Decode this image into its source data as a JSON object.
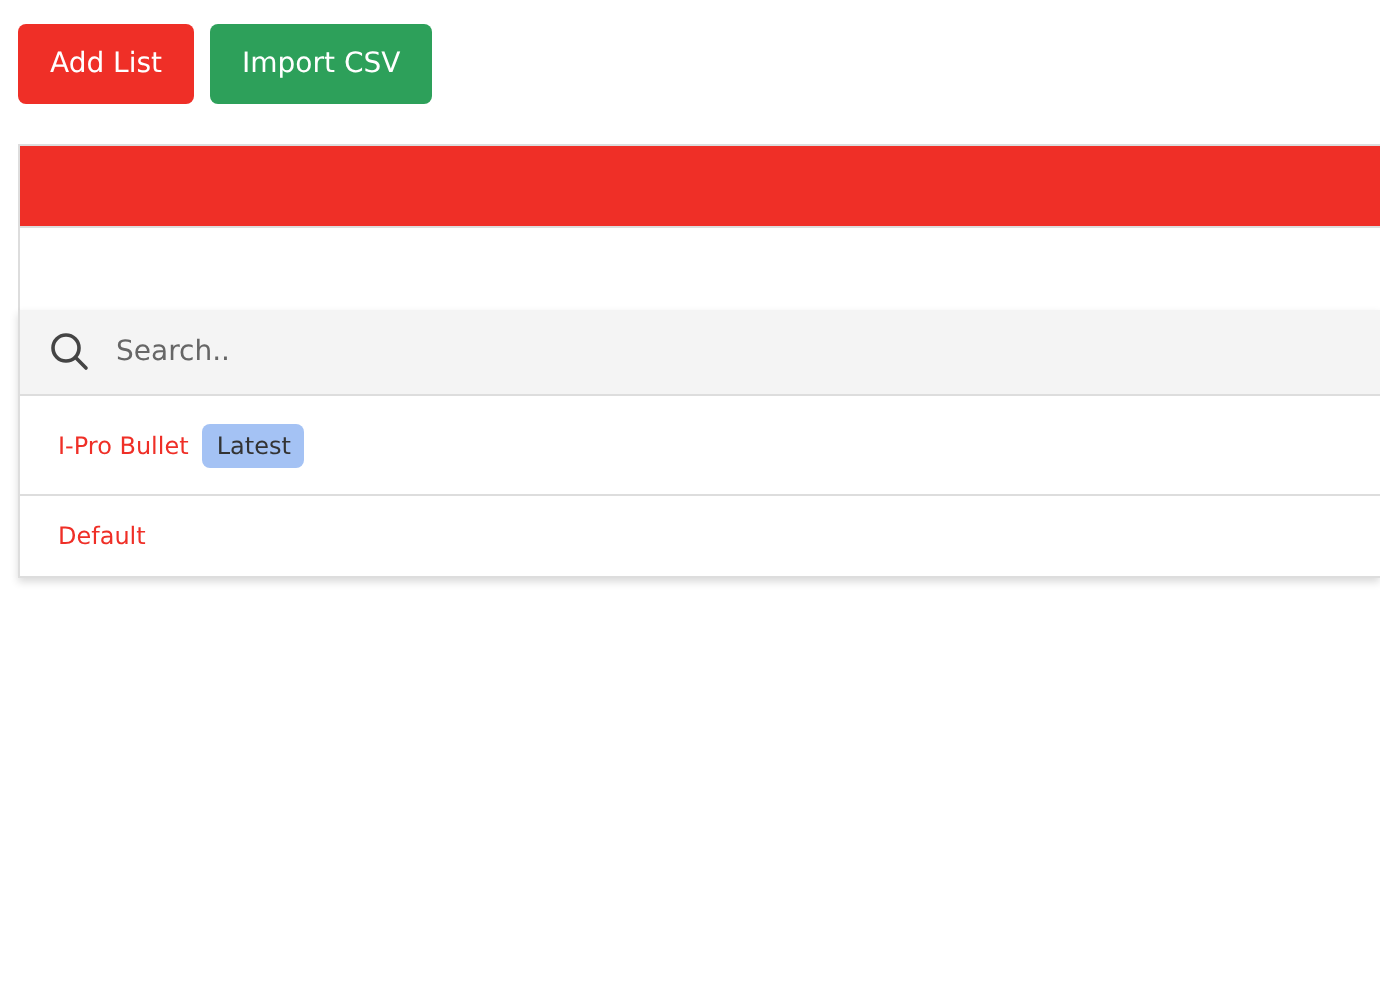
{
  "buttons": [
    {
      "label": "Add List",
      "kind": "primary"
    },
    {
      "label": "Import CSV",
      "kind": "success"
    }
  ],
  "search": {
    "placeholder": "Search.."
  },
  "lists": [
    {
      "name": "I-Pro Bullet",
      "badge": "Latest"
    },
    {
      "name": "Default"
    }
  ]
}
